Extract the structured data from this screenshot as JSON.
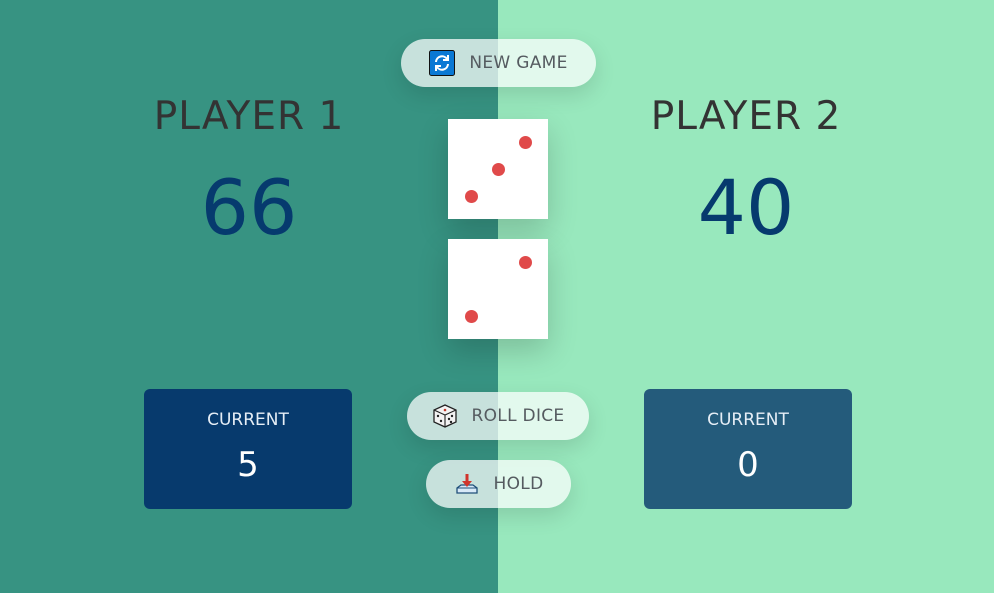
{
  "players": [
    {
      "name": "PLAYER 1",
      "score": "66",
      "current_label": "CURRENT",
      "current_value": "5"
    },
    {
      "name": "PLAYER 2",
      "score": "40",
      "current_label": "CURRENT",
      "current_value": "0"
    }
  ],
  "buttons": {
    "new_game": {
      "label": "NEW GAME",
      "icon": "refresh-icon"
    },
    "roll_dice": {
      "label": "ROLL DICE",
      "icon": "dice-icon"
    },
    "hold": {
      "label": "HOLD",
      "icon": "download-tray-icon"
    }
  },
  "dice": [
    {
      "value": 3
    },
    {
      "value": 2
    }
  ],
  "colors": {
    "player1_background": "#379382",
    "player2_background": "#98e8bd",
    "score_color": "#063a6e",
    "pip_color": "#e04a4a",
    "player1_current_box": "#073a6d",
    "player2_current_box": "#245b7b"
  }
}
